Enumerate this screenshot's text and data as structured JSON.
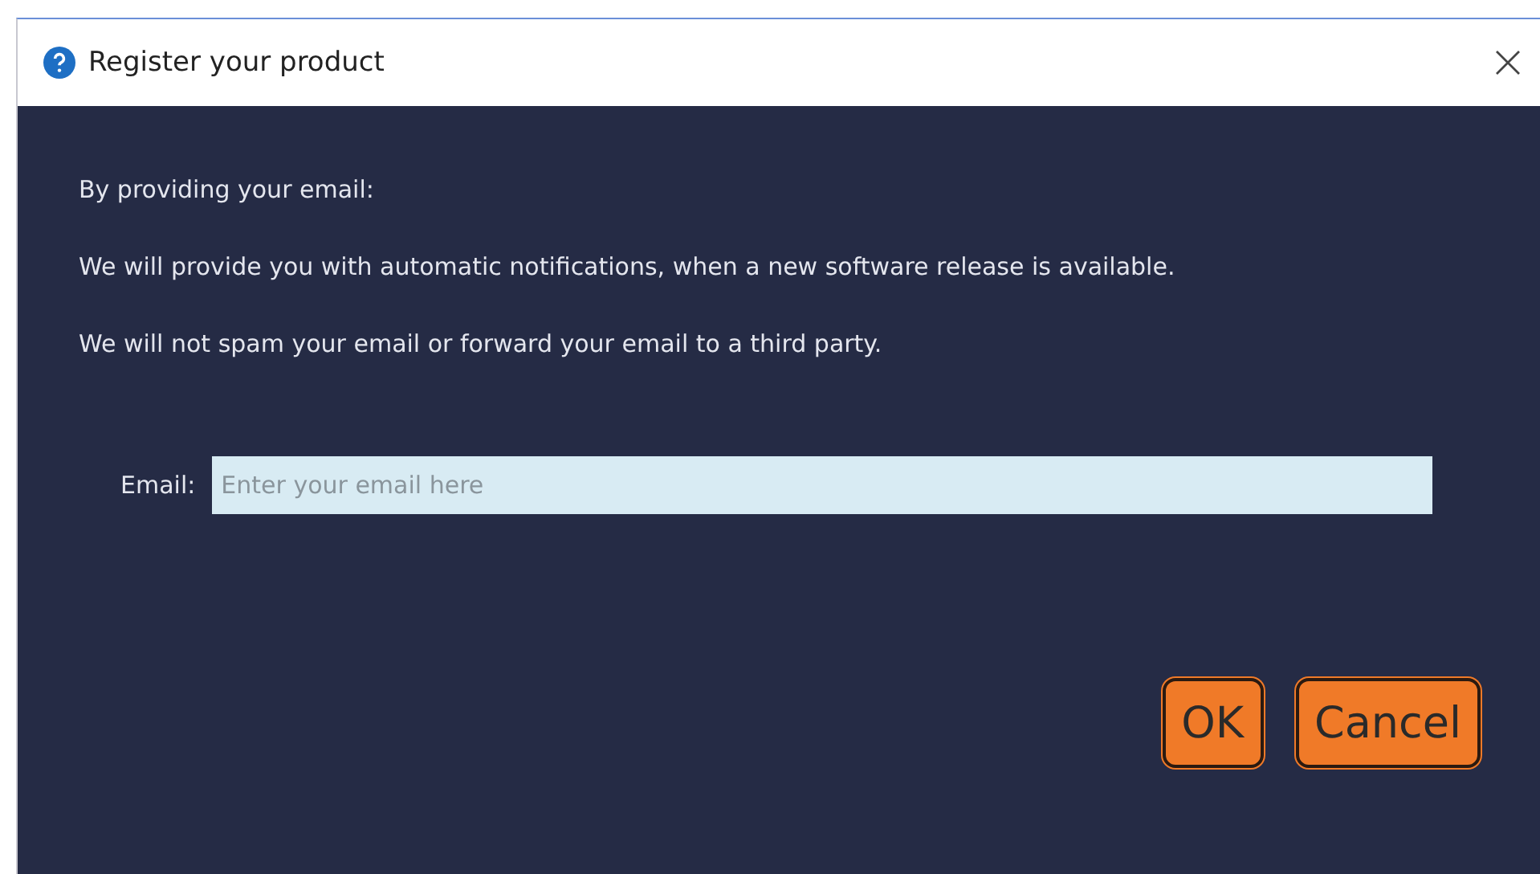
{
  "window": {
    "title": "Register your product"
  },
  "body": {
    "paragraphs": [
      "By providing your email:",
      "We will provide you with automatic notifications, when a new software release is available.",
      "We will not spam your email or forward your email to a third party."
    ]
  },
  "email": {
    "label": "Email:",
    "placeholder": "Enter your email here"
  },
  "buttons": [
    {
      "label": "OK"
    },
    {
      "label": "Cancel"
    }
  ]
}
